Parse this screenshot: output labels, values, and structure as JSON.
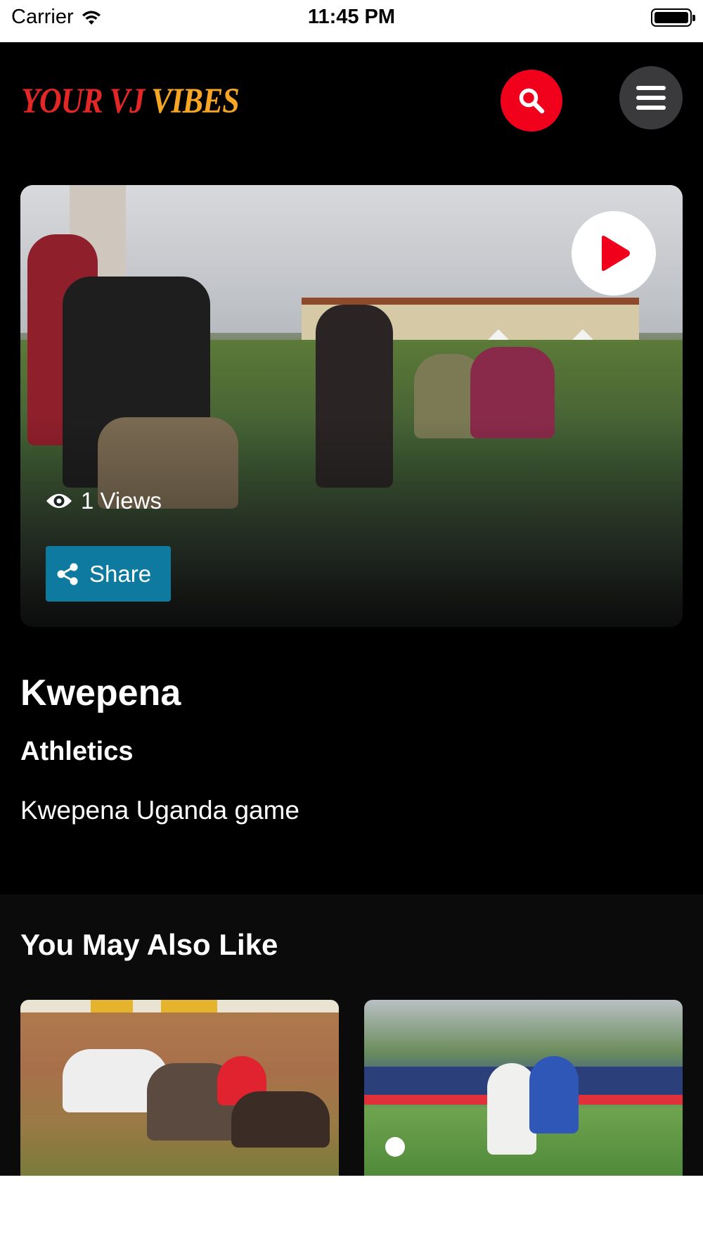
{
  "status_bar": {
    "carrier": "Carrier",
    "time": "11:45 PM"
  },
  "header": {
    "logo_part1": "YOUR VJ ",
    "logo_part2": "VIBES",
    "search_icon": "search-icon",
    "menu_icon": "hamburger-menu-icon"
  },
  "hero": {
    "views_label": "1 Views",
    "share_label": "Share",
    "play_icon": "play-icon"
  },
  "video": {
    "title": "Kwepena",
    "category": "Athletics",
    "description": "Kwepena Uganda game"
  },
  "related": {
    "heading": "You May Also Like"
  },
  "colors": {
    "accent_red": "#f1001c",
    "share_blue": "#0e7aa0",
    "background": "#000000",
    "menu_gray": "#3a3a3c"
  }
}
